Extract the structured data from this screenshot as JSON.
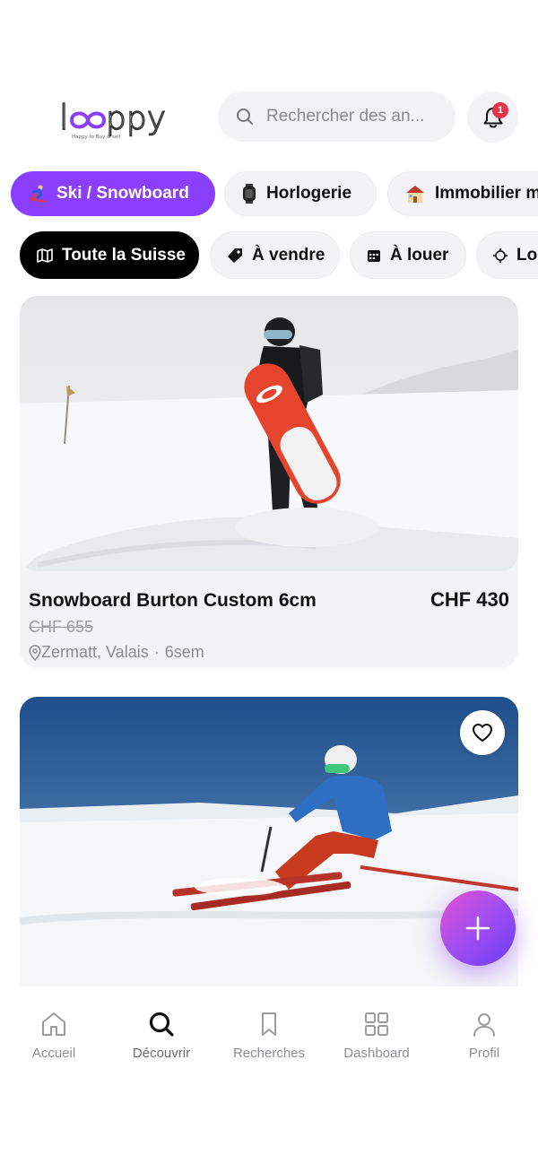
{
  "app": {
    "logo_text": "looppy",
    "logo_tagline": "Happy to Buy & sell",
    "brand_color": "#8a3ffc"
  },
  "search": {
    "placeholder": "Rechercher des an..."
  },
  "notifications": {
    "count": "1"
  },
  "categories": [
    {
      "icon": "skier-icon",
      "label": "Ski / Snowboard",
      "active": true
    },
    {
      "icon": "watch-icon",
      "label": "Horlogerie",
      "active": false
    },
    {
      "icon": "house-icon",
      "label": "Immobilier m",
      "active": false
    }
  ],
  "filters": [
    {
      "icon": "map-icon",
      "label": "Toute la Suisse",
      "active": true
    },
    {
      "icon": "tag-icon",
      "label": "À vendre",
      "active": false
    },
    {
      "icon": "calendar-icon",
      "label": "À louer",
      "active": false
    },
    {
      "icon": "location-target-icon",
      "label": "Loc",
      "active": false
    }
  ],
  "listings": [
    {
      "title": "Snowboard Burton Custom 6cm",
      "price": "CHF 430",
      "old_price": "CHF 655",
      "location": "Zermatt, Valais",
      "separator": "·",
      "age": "6sem"
    },
    {
      "favorited": false
    }
  ],
  "bottom_nav": [
    {
      "icon": "home-icon",
      "label": "Accueil",
      "active": false
    },
    {
      "icon": "search-icon",
      "label": "Découvrir",
      "active": true
    },
    {
      "icon": "bookmark-icon",
      "label": "Recherches",
      "active": false
    },
    {
      "icon": "grid-icon",
      "label": "Dashboard",
      "active": false
    },
    {
      "icon": "user-icon",
      "label": "Profil",
      "active": false
    }
  ]
}
